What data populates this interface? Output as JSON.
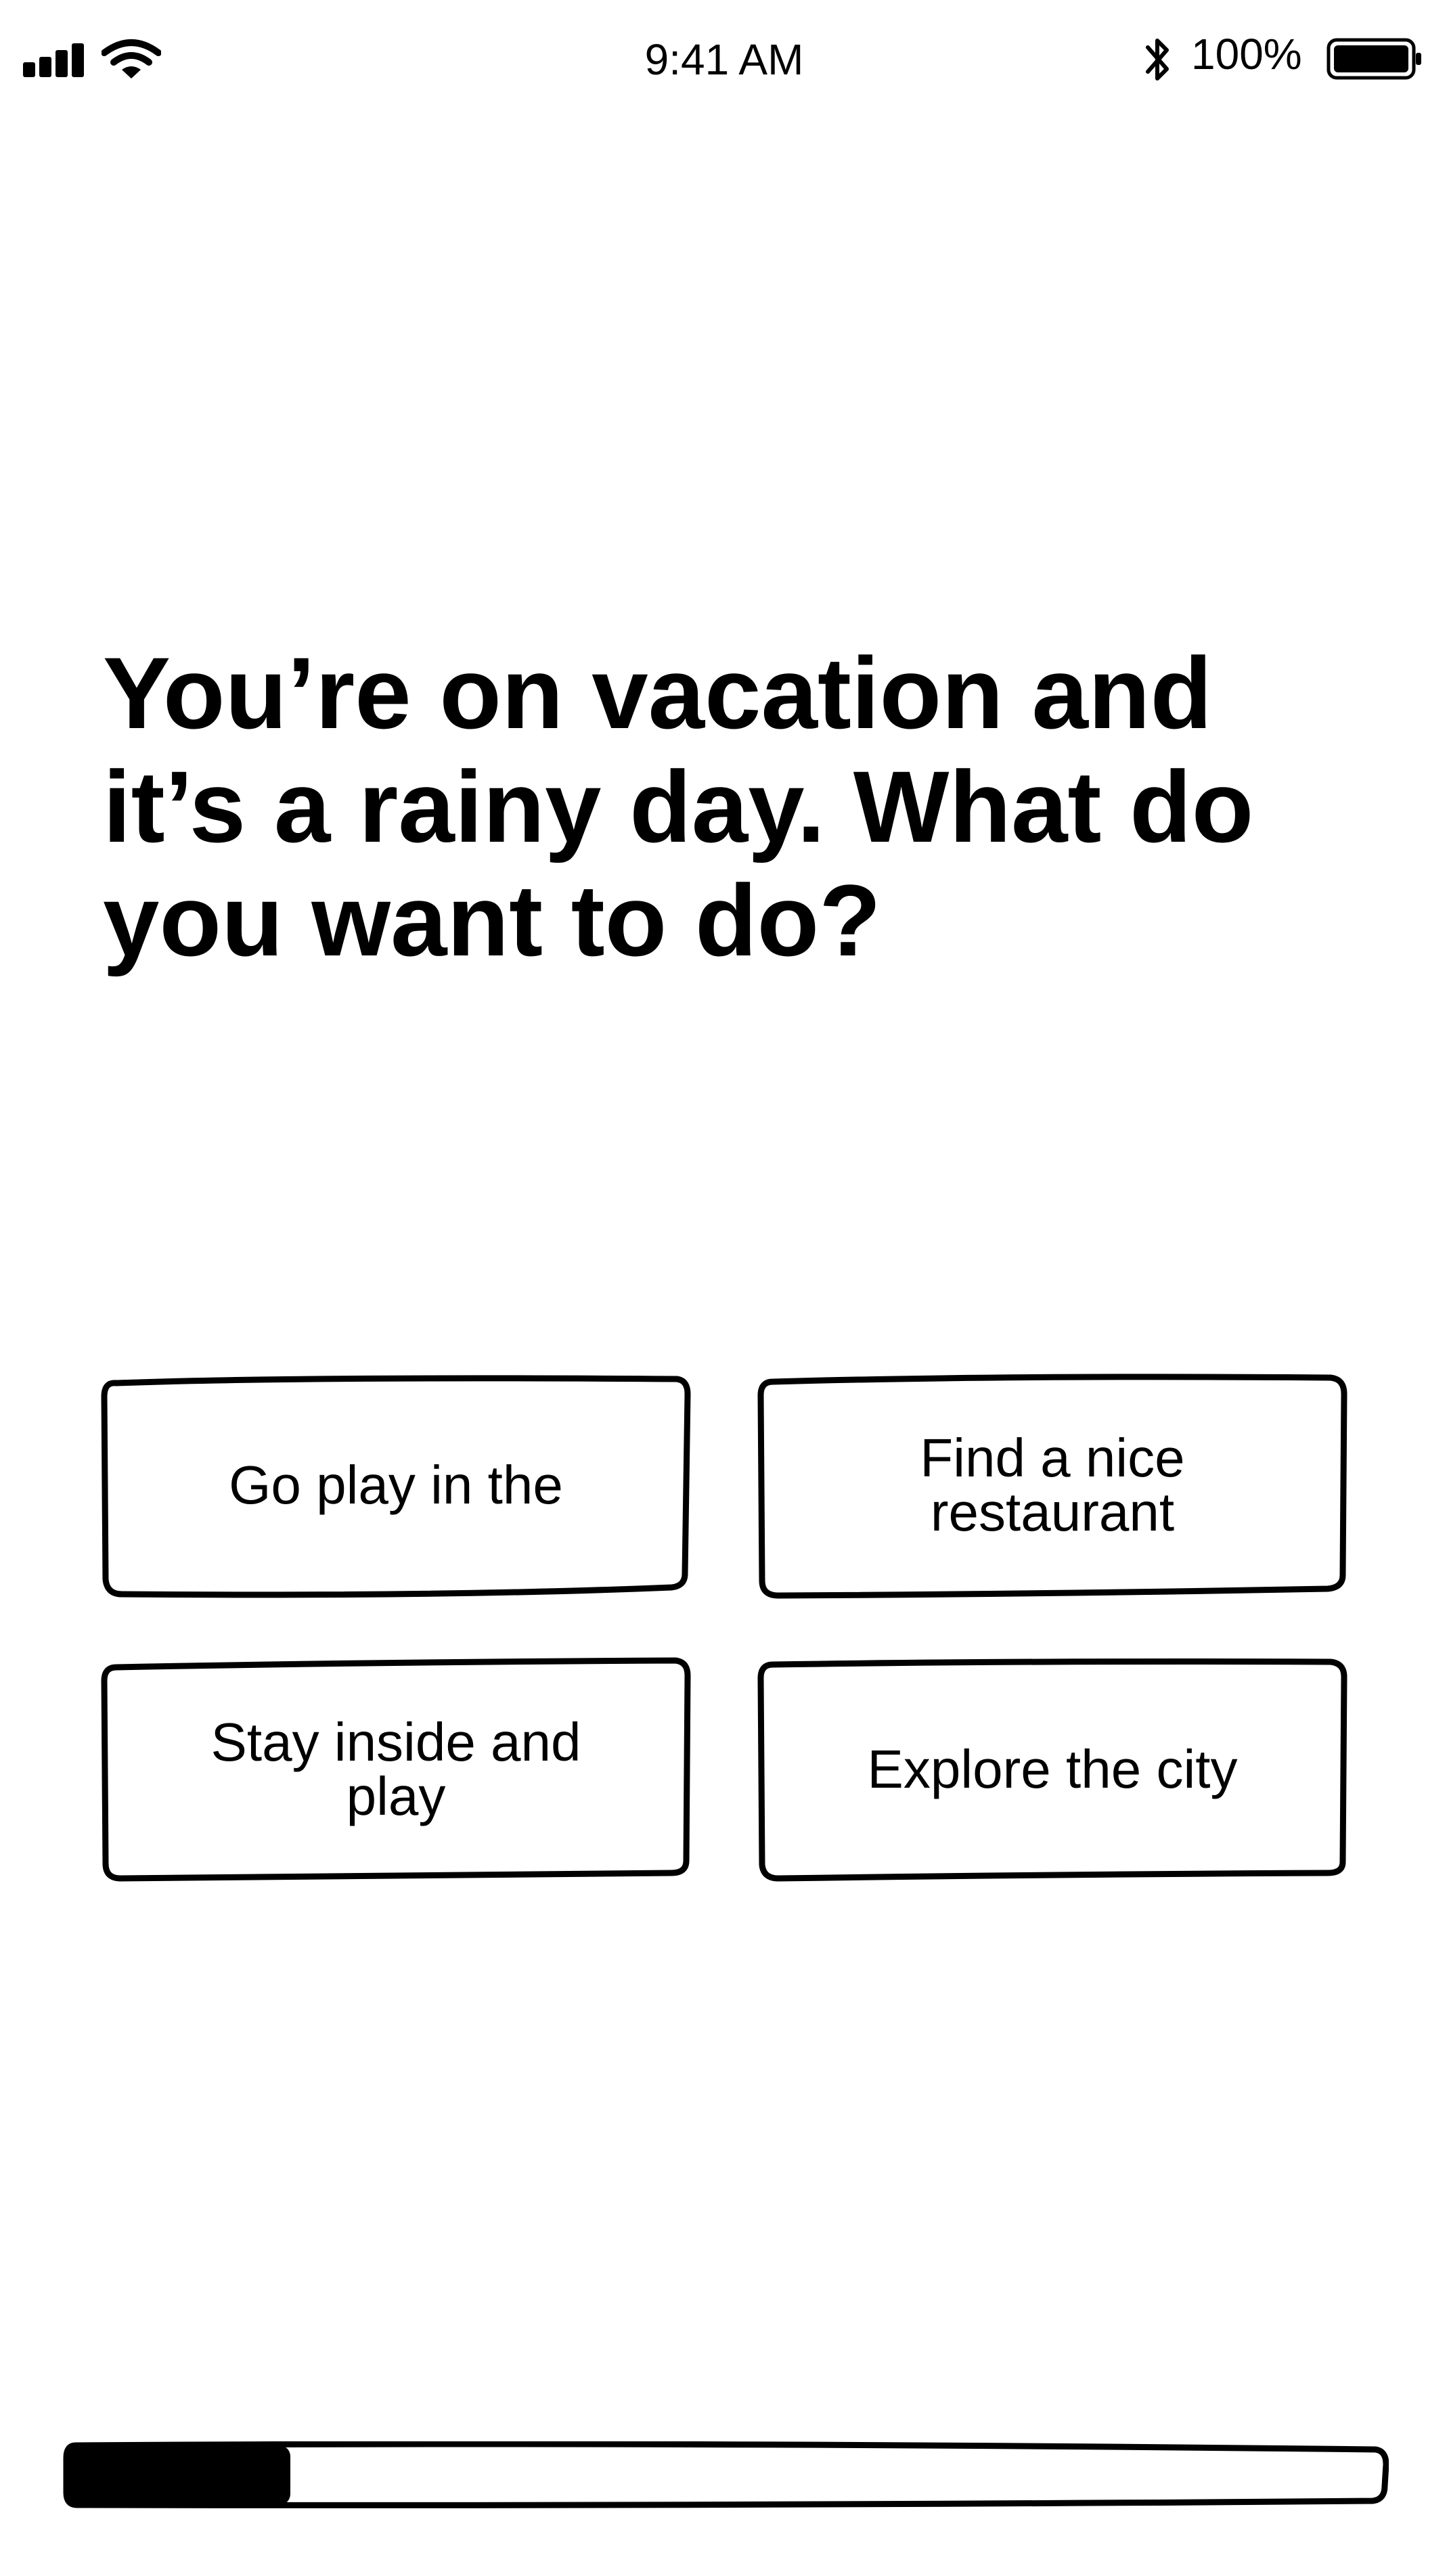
{
  "status_bar": {
    "time": "9:41 AM",
    "battery_percent": "100%",
    "icons": [
      "signal-icon",
      "wifi-icon",
      "bluetooth-icon",
      "battery-icon"
    ]
  },
  "question": {
    "text": "You’re on vacation and it’s a rainy day. What do you want to do?"
  },
  "answers": [
    {
      "label": "Go play in the"
    },
    {
      "label": "Find a nice restaurant"
    },
    {
      "label": "Stay inside and play"
    },
    {
      "label": "Explore the city"
    }
  ],
  "progress": {
    "fraction": 0.17,
    "fill_color": "#000000"
  }
}
